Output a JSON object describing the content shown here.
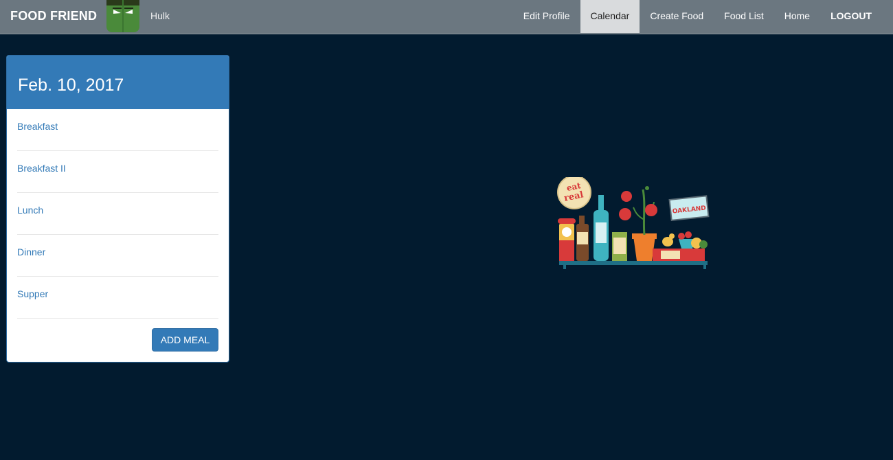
{
  "nav": {
    "brand": "FOOD FRIEND",
    "avatar_icon": "hulk-avatar-icon",
    "username": "Hulk",
    "links": [
      {
        "label": "Edit Profile"
      },
      {
        "label": "Calendar",
        "active": true
      },
      {
        "label": "Create Food"
      },
      {
        "label": "Food List"
      },
      {
        "label": "Home"
      },
      {
        "label": "LOGOUT"
      }
    ]
  },
  "calendar": {
    "date": "Feb. 10, 2017",
    "meals": [
      "Breakfast",
      "Breakfast II",
      "Lunch",
      "Dinner",
      "Supper"
    ],
    "add_meal_label": "ADD MEAL"
  },
  "illustration": {
    "badge_text": [
      "eat",
      "real"
    ],
    "sign_text": "OAKLAND"
  },
  "colors": {
    "background": "#021b2f",
    "navbar": "#6b7780",
    "primary": "#337ab7",
    "active_nav": "#d9dbdd"
  }
}
